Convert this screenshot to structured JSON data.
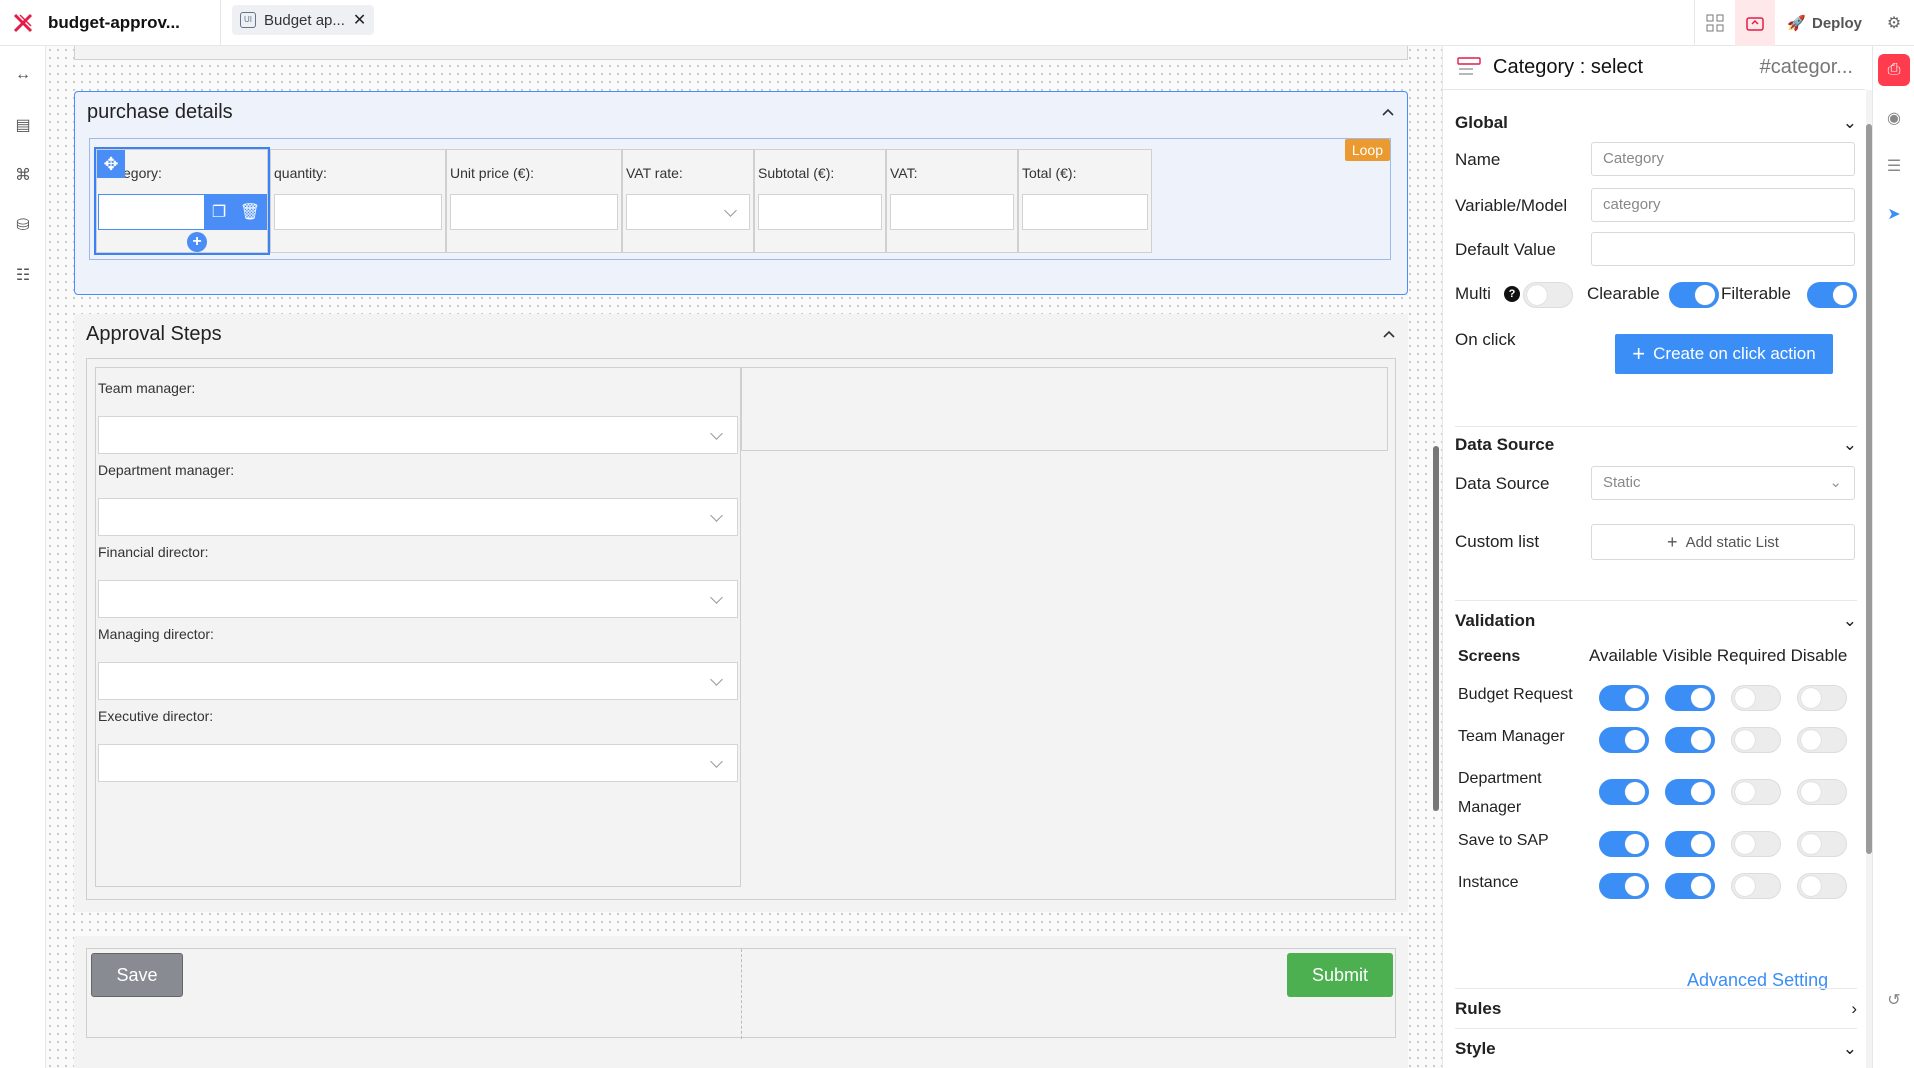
{
  "app": {
    "title": "budget-approv...",
    "tab_label": "Budget ap...",
    "deploy_label": "Deploy"
  },
  "purchase": {
    "title": "purchase details",
    "loop_tag": "Loop",
    "columns": [
      "egory:",
      "quantity:",
      "Unit price (€):",
      "VAT rate:",
      "Subtotal (€):",
      "VAT:",
      "Total (€):"
    ]
  },
  "approval": {
    "title": "Approval Steps",
    "fields": [
      "Team manager:",
      "Department manager:",
      "Financial director:",
      "Managing director:",
      "Executive director:"
    ]
  },
  "footer": {
    "save_label": "Save",
    "submit_label": "Submit"
  },
  "panel": {
    "title": "Category : select",
    "id": "#categor...",
    "global": {
      "section": "Global",
      "name_label": "Name",
      "name_placeholder": "Category",
      "variable_label": "Variable/Model",
      "variable_placeholder": "category",
      "default_label": "Default Value",
      "default_value": "",
      "multi_label": "Multi",
      "clearable_label": "Clearable",
      "filterable_label": "Filterable",
      "multi_on": false,
      "clearable_on": true,
      "filterable_on": true,
      "onclick_label": "On click",
      "create_action_label": "Create on click action"
    },
    "datasource": {
      "section": "Data Source",
      "source_label": "Data Source",
      "source_value": "Static",
      "custom_label": "Custom list",
      "add_static_label": "Add static List"
    },
    "validation": {
      "section": "Validation",
      "screens_header": "Screens",
      "col_headers": "Available Visible Required Disable",
      "rows": [
        {
          "label": "Budget Request",
          "available": true,
          "visible": true,
          "required": false,
          "disable": false
        },
        {
          "label": "Team Manager",
          "available": true,
          "visible": true,
          "required": false,
          "disable": false
        },
        {
          "label": "Department Manager",
          "available": true,
          "visible": true,
          "required": false,
          "disable": false
        },
        {
          "label": "Save to SAP",
          "available": true,
          "visible": true,
          "required": false,
          "disable": false
        },
        {
          "label": "Instance",
          "available": true,
          "visible": true,
          "required": false,
          "disable": false
        }
      ],
      "advanced_label": "Advanced Setting"
    },
    "rules_section": "Rules",
    "style_section": "Style"
  },
  "colors": {
    "accent": "#3b8ef6",
    "submit": "#4caf50",
    "loop": "#ea9a2f",
    "brand": "#e11d48"
  }
}
